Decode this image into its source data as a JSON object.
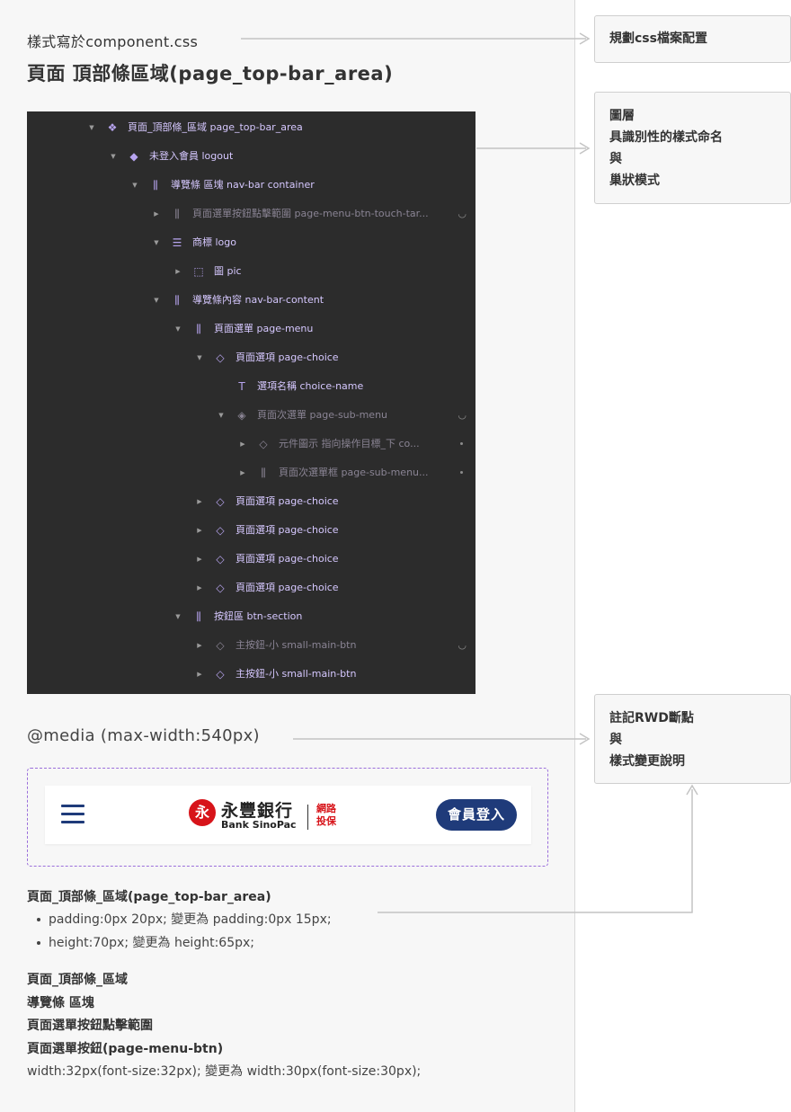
{
  "header": {
    "css_file": "樣式寫於component.css",
    "page_title": "頁面 頂部條區域(page_top-bar_area)"
  },
  "layers": [
    {
      "name": "頁面_頂部條_區域 page_top-bar_area",
      "icon": "component-icon",
      "glyph": "❖",
      "caret": "▼",
      "depth": 0,
      "dim": false
    },
    {
      "name": "未登入會員 logout",
      "icon": "variant-diamond-icon",
      "glyph": "◆",
      "caret": "▼",
      "depth": 1,
      "dim": false
    },
    {
      "name": "導覽條 區塊 nav-bar container",
      "icon": "horizontal-layout-icon",
      "glyph": "⫼",
      "caret": "▼",
      "depth": 2,
      "dim": false
    },
    {
      "name": "頁面選單按鈕點擊範圍 page-menu-btn-touch-tar...",
      "icon": "horizontal-layout-icon",
      "glyph": "⫼",
      "caret": "▶",
      "depth": 3,
      "dim": true,
      "marker": "eye"
    },
    {
      "name": "商標 logo",
      "icon": "text-align-icon",
      "glyph": "☰",
      "caret": "▼",
      "depth": 3,
      "dim": false
    },
    {
      "name": "圖 pic",
      "icon": "frame-icon",
      "glyph": "⬚",
      "caret": "▶",
      "depth": 4,
      "dim": false
    },
    {
      "name": "導覽條內容 nav-bar-content",
      "icon": "horizontal-layout-icon",
      "glyph": "⫼",
      "caret": "▼",
      "depth": 3,
      "dim": false
    },
    {
      "name": "頁面選單 page-menu",
      "icon": "horizontal-layout-icon",
      "glyph": "⫼",
      "caret": "▼",
      "depth": 4,
      "dim": false
    },
    {
      "name": "頁面選項 page-choice",
      "icon": "instance-icon",
      "glyph": "◇",
      "caret": "▼",
      "depth": 5,
      "dim": false
    },
    {
      "name": "選項名稱 choice-name",
      "icon": "text-icon",
      "glyph": "T",
      "caret": "",
      "depth": 6,
      "dim": false
    },
    {
      "name": "頁面次選單 page-sub-menu",
      "icon": "instance-frame-icon",
      "glyph": "◈",
      "caret": "▼",
      "depth": 6,
      "dim": true,
      "marker": "eye"
    },
    {
      "name": "元件圖示 指向操作目標_下 co...",
      "icon": "instance-icon",
      "glyph": "◇",
      "caret": "▶",
      "depth": 7,
      "dim": true,
      "marker": "dot"
    },
    {
      "name": "頁面次選單框 page-sub-menu...",
      "icon": "vertical-layout-icon",
      "glyph": "⫼",
      "caret": "▶",
      "depth": 7,
      "dim": true,
      "marker": "dot"
    },
    {
      "name": "頁面選項 page-choice",
      "icon": "instance-icon",
      "glyph": "◇",
      "caret": "▶",
      "depth": 5,
      "dim": false
    },
    {
      "name": "頁面選項 page-choice",
      "icon": "instance-icon",
      "glyph": "◇",
      "caret": "▶",
      "depth": 5,
      "dim": false
    },
    {
      "name": "頁面選項 page-choice",
      "icon": "instance-icon",
      "glyph": "◇",
      "caret": "▶",
      "depth": 5,
      "dim": false
    },
    {
      "name": "頁面選項 page-choice",
      "icon": "instance-icon",
      "glyph": "◇",
      "caret": "▶",
      "depth": 5,
      "dim": false
    },
    {
      "name": "按鈕區 btn-section",
      "icon": "vertical-layout-icon",
      "glyph": "⫼",
      "caret": "▼",
      "depth": 4,
      "dim": false
    },
    {
      "name": "主按鈕-小 small-main-btn",
      "icon": "instance-icon",
      "glyph": "◇",
      "caret": "▶",
      "depth": 5,
      "dim": true,
      "marker": "eye"
    },
    {
      "name": "主按鈕-小 small-main-btn",
      "icon": "instance-icon",
      "glyph": "◇",
      "caret": "▶",
      "depth": 5,
      "dim": false
    }
  ],
  "media": {
    "query": "@media (max-width:540px)"
  },
  "preview": {
    "menu_icon": "hamburger-icon",
    "logo_mark": "永",
    "logo_zh": "永豐銀行",
    "logo_en": "Bank SinoPac",
    "logo_web_1": "網路",
    "logo_web_2": "投保",
    "login_label": "會員登入",
    "brand_color": "#1f3b7a",
    "accent_color": "#d7141a"
  },
  "notes_area": {
    "heading": "頁面_頂部條_區域(page_top-bar_area)",
    "items": [
      "padding:0px 20px; 變更為 padding:0px 15px;",
      "height:70px; 變更為 height:65px;"
    ]
  },
  "notes_btn": {
    "line1": "頁面_頂部條_區域",
    "line2": "導覽條 區塊",
    "line3": "頁面選單按鈕點擊範圍",
    "line4": "頁面選單按鈕(page-menu-btn)",
    "line5": "width:32px(font-size:32px); 變更為 width:30px(font-size:30px);"
  },
  "callouts": {
    "css_plan": "規劃css檔案配置",
    "layers_1": "圖層",
    "layers_2": "具識別性的樣式命名",
    "layers_3": "與",
    "layers_4": "巢狀模式",
    "rwd_1": "註記RWD斷點",
    "rwd_2": "與",
    "rwd_3": "樣式變更說明"
  }
}
